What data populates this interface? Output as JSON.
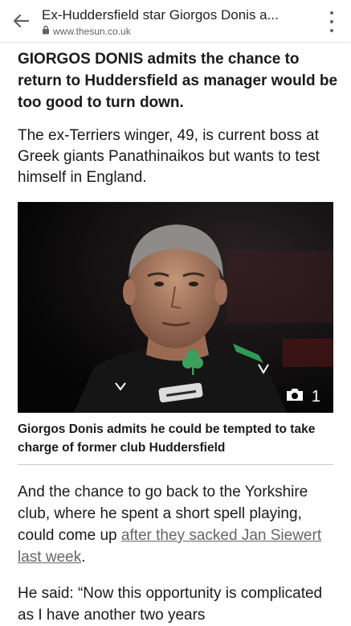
{
  "browser": {
    "title": "Ex-Huddersfield star Giorgos Donis a...",
    "url": "www.thesun.co.uk",
    "icons": {
      "back": "back-arrow-icon",
      "lock": "lock-icon",
      "menu": "more-vert-icon"
    }
  },
  "article": {
    "headline": "GIORGOS DONIS admits the chance to return to Huddersfield as manager would be too good to turn down.",
    "standfirst": "The ex-Terriers winger, 49, is current boss at Greek giants Panathinaikos but wants to test himself in England.",
    "image": {
      "photo_count": "1",
      "camera_icon": "camera-icon",
      "caption": "Giorgos Donis admits he could be tempted to take charge of former club Huddersfield"
    },
    "paragraph1": {
      "text": "And the chance to go back to the Yorkshire club, where he spent a short spell playing, could come up ",
      "link": "after they sacked Jan Siewert last week",
      "end": "."
    },
    "paragraph2": "He said: “Now this opportunity is complicated as I have another two years"
  },
  "colors": {
    "link": "#666666",
    "text": "#1a1a1a",
    "divider": "#c9c9c9"
  }
}
